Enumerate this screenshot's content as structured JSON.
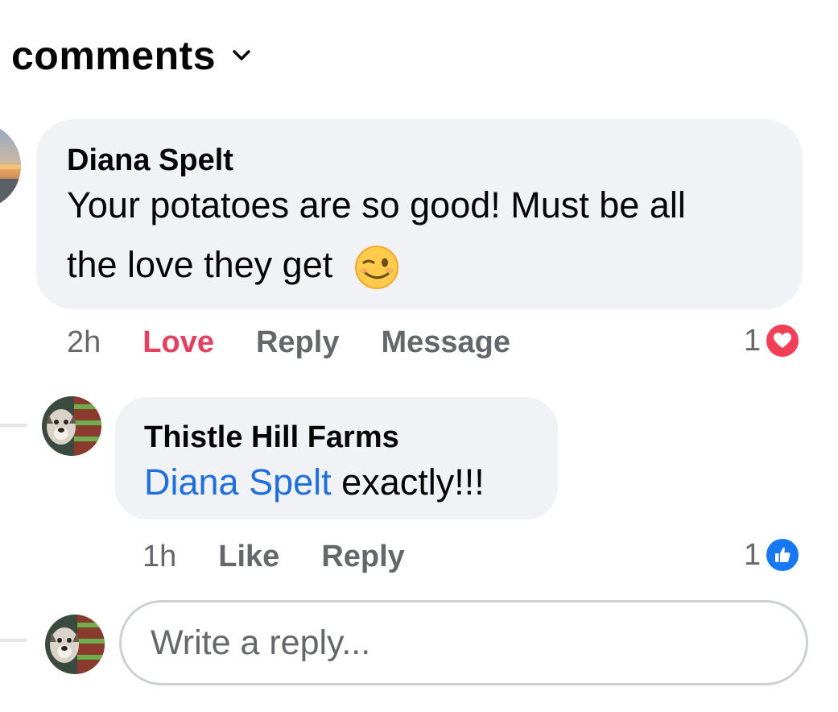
{
  "header": {
    "title": "comments",
    "chevron_icon": "chevron-down-icon"
  },
  "comments": [
    {
      "author": "Diana Spelt",
      "text_line1": "Your potatoes are so good! Must be all",
      "text_line2": "the love they get",
      "emoji": "😉",
      "time": "2h",
      "actions": [
        "Love",
        "Reply",
        "Message"
      ],
      "reaction_count": "1",
      "reaction_icon": "heart-icon",
      "reaction_color": "#f33e58"
    },
    {
      "author": "Thistle Hill Farms",
      "mention": "Diana Spelt",
      "text": "exactly!!!",
      "time": "1h",
      "actions": [
        "Like",
        "Reply"
      ],
      "reaction_count": "1",
      "reaction_icon": "thumbs-up-icon",
      "reaction_color": "#1877f2"
    }
  ],
  "reply_box": {
    "placeholder": "Write a reply..."
  },
  "colors": {
    "bubble": "#f0f2f5",
    "love": "#e4405f",
    "mention": "#216fdb",
    "muted": "#65676b"
  }
}
